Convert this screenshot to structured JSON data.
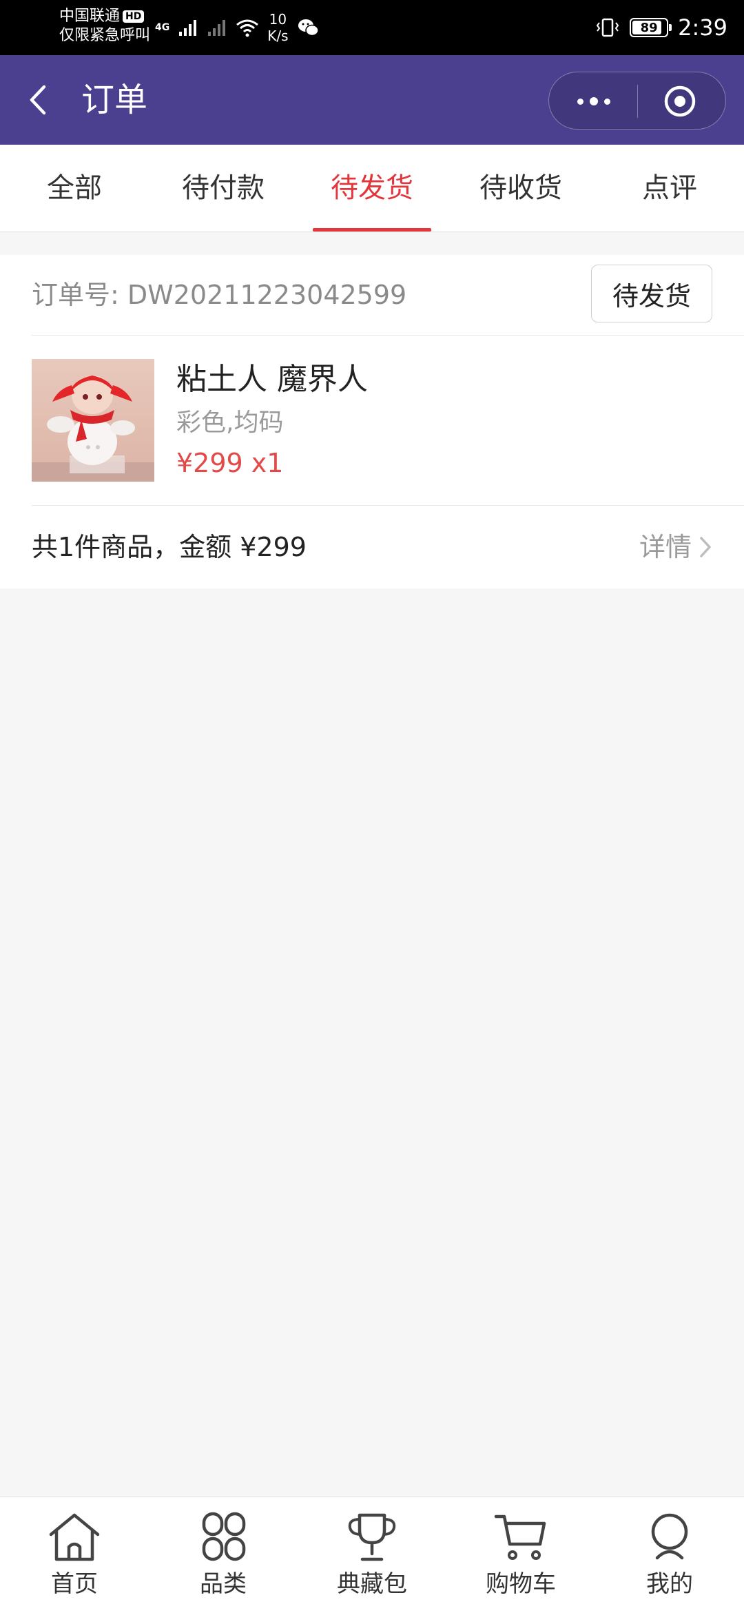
{
  "status_bar": {
    "carrier_line1": "中国联通",
    "carrier_badge": "HD",
    "carrier_line2": "仅限紧急呼叫",
    "network_type": "4G",
    "speed_value": "10",
    "speed_unit": "K/s",
    "battery": "89",
    "battery_level": 0.89,
    "time": "2:39"
  },
  "nav": {
    "title": "订单"
  },
  "tabs": [
    {
      "label": "全部"
    },
    {
      "label": "待付款"
    },
    {
      "label": "待发货"
    },
    {
      "label": "待收货"
    },
    {
      "label": "点评"
    }
  ],
  "active_tab": "待发货",
  "order": {
    "number_label": "订单号:",
    "number": "DW20211223042599",
    "status_button": "待发货",
    "product_name": "粘土人 魔界人",
    "product_spec": "彩色,均码",
    "product_price": "¥299 x1",
    "summary": "共1件商品，金额  ¥299",
    "detail_link": "详情"
  },
  "tabbar": [
    {
      "label": "首页",
      "icon": "home-icon"
    },
    {
      "label": "品类",
      "icon": "category-icon"
    },
    {
      "label": "典藏包",
      "icon": "trophy-icon"
    },
    {
      "label": "购物车",
      "icon": "cart-icon"
    },
    {
      "label": "我的",
      "icon": "profile-icon"
    }
  ],
  "colors": {
    "nav_bg": "#4b3f8f",
    "accent_red": "#e0363c",
    "price_red": "#e24a4a"
  }
}
